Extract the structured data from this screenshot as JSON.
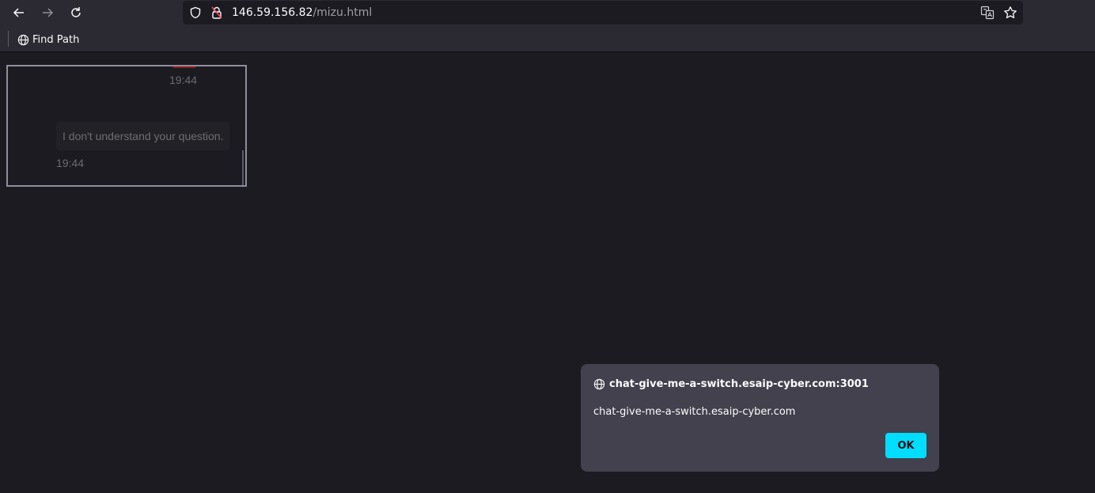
{
  "browser": {
    "url_host": "146.59.156.82",
    "url_path": "/mizu.html",
    "icons": {
      "back": "arrow-left-icon",
      "forward": "arrow-right-icon",
      "reload": "reload-icon",
      "tracking": "shield-icon",
      "insecure": "lock-warning-icon",
      "translate": "translate-icon",
      "bookmark": "star-icon"
    }
  },
  "bookmarks_bar": {
    "items": [
      {
        "label": "Find Path",
        "icon": "globe-icon"
      }
    ]
  },
  "chat_frame": {
    "messages": [
      {
        "side": "right",
        "text": "",
        "time": "19:44"
      },
      {
        "side": "left",
        "text": "I don't understand your question.",
        "time": "19:44"
      }
    ]
  },
  "alert_dialog": {
    "origin": "chat-give-me-a-switch.esaip-cyber.com:3001",
    "message": "chat-give-me-a-switch.esaip-cyber.com",
    "ok_label": "OK",
    "accent": "#00ddff"
  }
}
